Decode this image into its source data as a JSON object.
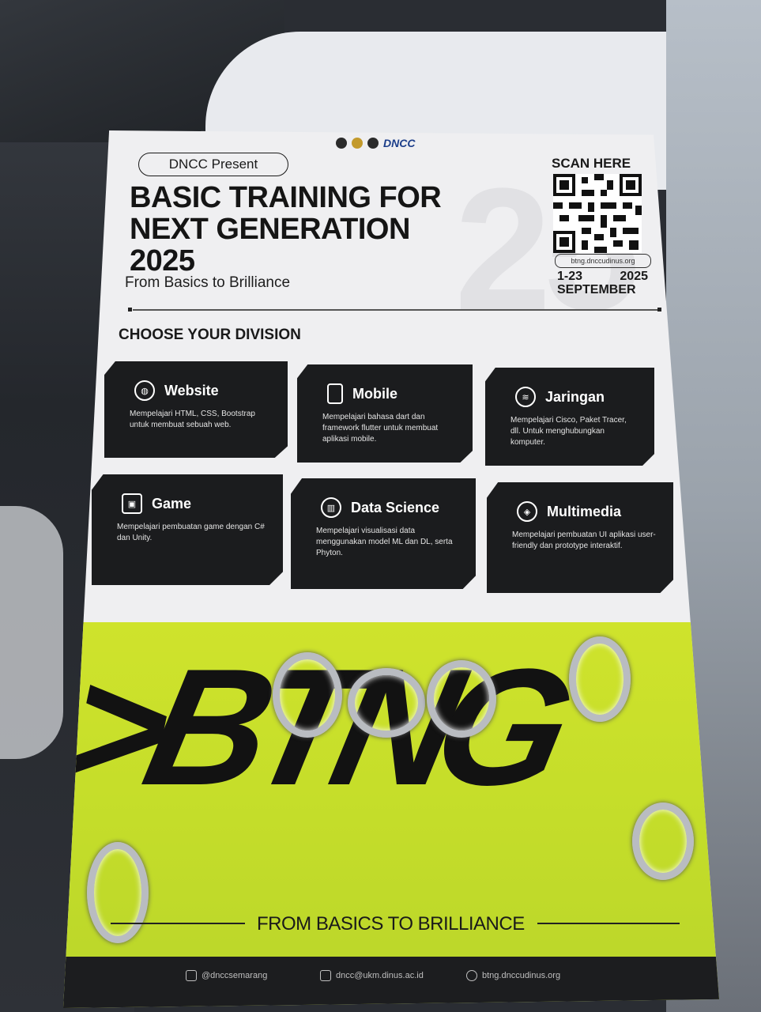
{
  "poster": {
    "logo_text": "DNCC",
    "present": "DNCC Present",
    "title_lines": [
      "BASIC TRAINING FOR",
      "NEXT GENERATION",
      "2025"
    ],
    "subtitle": "From Basics to Brilliance",
    "scan": "SCAN HERE",
    "url": "btng.dnccudinus.org",
    "date_range": "1-23",
    "year": "2025",
    "month": "SEPTEMBER",
    "choose": "CHOOSE YOUR DIVISION",
    "divisions": [
      {
        "name": "Website",
        "icon": "globe-icon",
        "desc": "Mempelajari HTML, CSS, Bootstrap untuk membuat sebuah web."
      },
      {
        "name": "Mobile",
        "icon": "phone-icon",
        "desc": "Mempelajari bahasa dart dan framework flutter untuk membuat aplikasi mobile."
      },
      {
        "name": "Jaringan",
        "icon": "wifi-icon",
        "desc": "Mempelajari Cisco, Paket Tracer, dll. Untuk menghubungkan komputer."
      },
      {
        "name": "Game",
        "icon": "gamepad-icon",
        "desc": "Mempelajari pembuatan game dengan C# dan Unity."
      },
      {
        "name": "Data Science",
        "icon": "chart-icon",
        "desc": "Mempelajari visualisasi data menggunakan model ML dan DL, serta Phyton."
      },
      {
        "name": "Multimedia",
        "icon": "compass-icon",
        "desc": "Mempelajari pembuatan UI aplikasi user-friendly dan prototype interaktif."
      }
    ],
    "footer": "FROM BASICS TO BRILLIANCE",
    "instagram": "@dnccsemarang",
    "email": "dncc@ukm.dinus.ac.id",
    "website": "btng.dnccudinus.org"
  },
  "colors": {
    "accent": "#c8df2c",
    "card": "#1b1c1e",
    "paper": "#efeff1"
  }
}
